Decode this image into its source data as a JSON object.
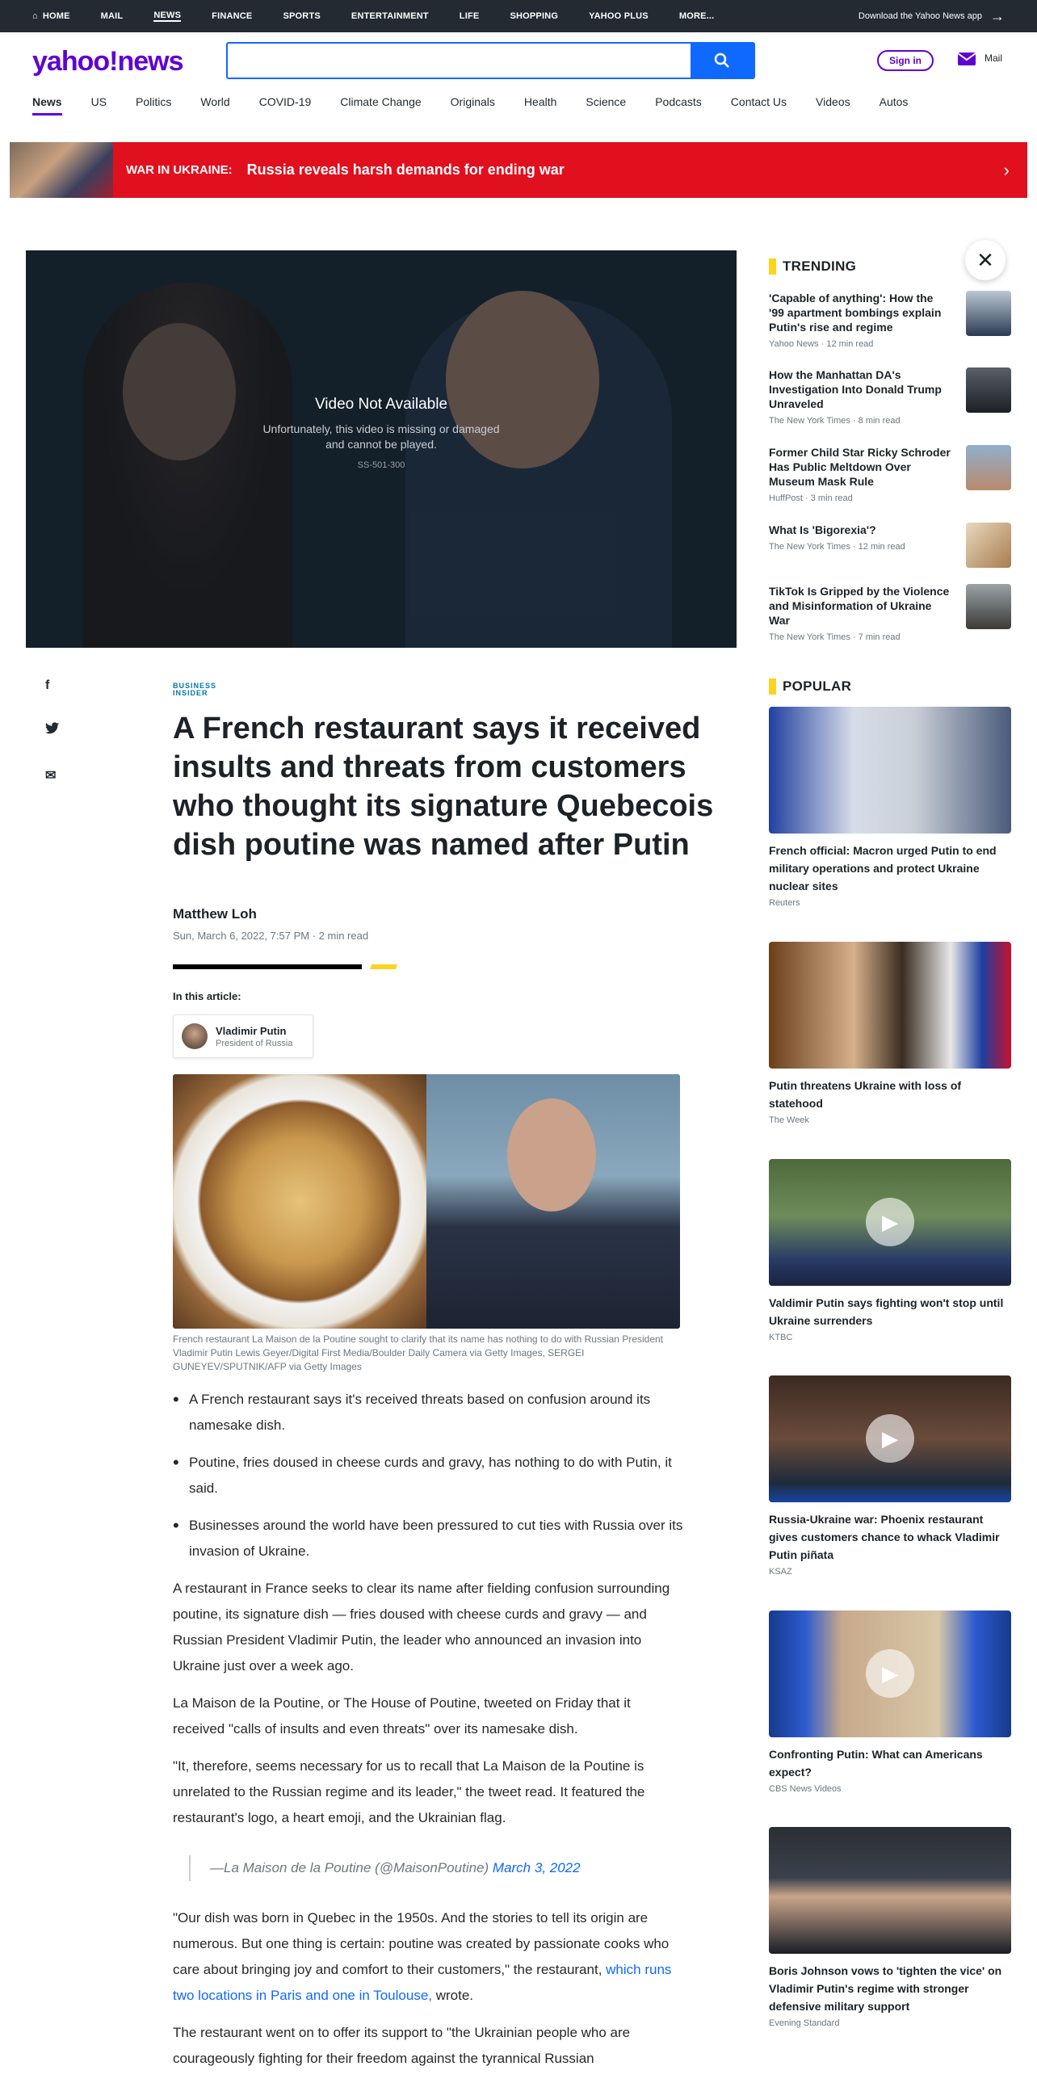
{
  "topnav": {
    "items": [
      "HOME",
      "MAIL",
      "NEWS",
      "FINANCE",
      "SPORTS",
      "ENTERTAINMENT",
      "LIFE",
      "SHOPPING",
      "YAHOO PLUS",
      "MORE..."
    ],
    "download": "Download the Yahoo News app"
  },
  "header": {
    "logo": "yahoo!news",
    "signin": "Sign in",
    "mail": "Mail",
    "search_value": ""
  },
  "catnav": [
    "News",
    "US",
    "Politics",
    "World",
    "COVID-19",
    "Climate Change",
    "Originals",
    "Health",
    "Science",
    "Podcasts",
    "Contact Us",
    "Videos",
    "Autos"
  ],
  "banner": {
    "label": "WAR IN UKRAINE:",
    "text": "Russia reveals harsh demands for ending war"
  },
  "video": {
    "title": "Video Not Available",
    "msg": "Unfortunately, this video is missing or damaged and cannot be played.",
    "code": "SS-501-300"
  },
  "article": {
    "publisher": "BUSINESS INSIDER",
    "title": "A French restaurant says it received insults and threats from customers who thought its signature Quebecois dish poutine was named after Putin",
    "author": "Matthew Loh",
    "date": "Sun, March 6, 2022, 7:57 PM · 2 min read",
    "in_this_article": "In this article:",
    "entity_name": "Vladimir Putin",
    "entity_role": "President of Russia",
    "caption": "French restaurant La Maison de la Poutine sought to clarify that its name has nothing to do with Russian President Vladimir Putin Lewis Geyer/Digital First Media/Boulder Daily Camera via Getty Images, SERGEI GUNEYEV/SPUTNIK/AFP via Getty Images",
    "bullets": [
      "A French restaurant says it's received threats based on confusion around its namesake dish.",
      "Poutine, fries doused in cheese curds and gravy, has nothing to do with Putin, it said.",
      "Businesses around the world have been pressured to cut ties with Russia over its invasion of Ukraine."
    ],
    "p1": "A restaurant in France seeks to clear its name after fielding confusion surrounding poutine, its signature dish — fries doused with cheese curds and gravy — and Russian President Vladimir Putin, the leader who announced an invasion into Ukraine just over a week ago.",
    "p2": "La Maison de la Poutine, or The House of Poutine, tweeted on Friday that it received \"calls of insults and even threats\" over its namesake dish.",
    "p3": "\"It, therefore, seems necessary for us to recall that La Maison de la Poutine is unrelated to the Russian regime and its leader,\" the tweet read. It featured the restaurant's logo, a heart emoji, and the Ukrainian flag.",
    "quote": "—La Maison de la Poutine (@MaisonPoutine)",
    "quote_date": "March 3, 2022",
    "p4a": "\"Our dish was born in Quebec in the 1950s. And the stories to tell its origin are numerous. But one thing is certain: poutine was created by passionate cooks who care about bringing joy and comfort to their customers,\" the restaurant, ",
    "p4link": "which runs two locations in Paris and one in Toulouse,",
    "p4b": " wrote.",
    "p5": "The restaurant went on to offer its support to \"the Ukrainian people who are courageously fighting for their freedom against the tyrannical Russian"
  },
  "trending": {
    "title": "TRENDING",
    "items": [
      {
        "t": "'Capable of anything': How the '99 apartment bombings explain Putin's rise and regime",
        "m": "Yahoo News · 12 min read"
      },
      {
        "t": "How the Manhattan DA's Investigation Into Donald Trump Unraveled",
        "m": "The New York Times · 8 min read"
      },
      {
        "t": "Former Child Star Ricky Schroder Has Public Meltdown Over Museum Mask Rule",
        "m": "HuffPost · 3 min read"
      },
      {
        "t": "What Is 'Bigorexia'?",
        "m": "The New York Times · 12 min read"
      },
      {
        "t": "TikTok Is Gripped by the Violence and Misinformation of Ukraine War",
        "m": "The New York Times · 7 min read"
      }
    ]
  },
  "popular": {
    "title": "POPULAR",
    "items": [
      {
        "t": "French official: Macron urged Putin to end military operations and protect Ukraine nuclear sites",
        "m": "Reuters"
      },
      {
        "t": "Putin threatens Ukraine with loss of statehood",
        "m": "The Week"
      },
      {
        "t": "Valdimir Putin says fighting won't stop until Ukraine surrenders",
        "m": "KTBC"
      },
      {
        "t": "Russia-Ukraine war: Phoenix restaurant gives customers chance to whack Vladimir Putin piñata",
        "m": "KSAZ"
      },
      {
        "t": "Confronting Putin: What can Americans expect?",
        "m": "CBS News Videos"
      },
      {
        "t": "Boris Johnson vows to 'tighten the vice' on Vladimir Putin's regime with stronger defensive military support",
        "m": "Evening Standard"
      }
    ]
  }
}
